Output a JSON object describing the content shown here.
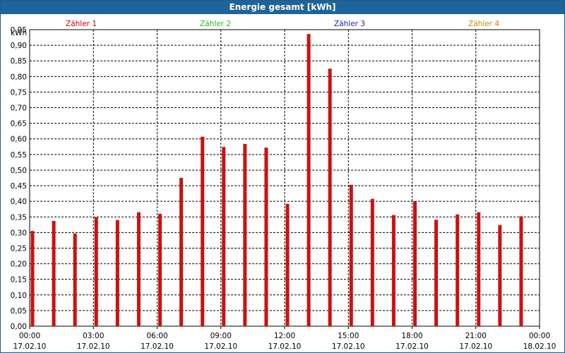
{
  "window": {
    "title": "Energie gesamt [kWh]"
  },
  "legend": [
    {
      "name": "Zähler 1",
      "color": "#cc0000"
    },
    {
      "name": "Zähler 2",
      "color": "#22bb22"
    },
    {
      "name": "Zähler 3",
      "color": "#2020aa"
    },
    {
      "name": "Zähler 4",
      "color": "#cc8800"
    }
  ],
  "chart_data": {
    "type": "bar",
    "title": "Energie gesamt [kWh]",
    "ylabel": "kWh",
    "ylim": [
      0,
      0.95
    ],
    "yticks": [
      "0,00",
      "0,05",
      "0,10",
      "0,15",
      "0,20",
      "0,25",
      "0,30",
      "0,35",
      "0,40",
      "0,45",
      "0,50",
      "0,55",
      "0,60",
      "0,65",
      "0,70",
      "0,75",
      "0,80",
      "0,85",
      "0,90",
      "0,95"
    ],
    "xticks": [
      {
        "time": "00:00",
        "date": "17.02.10"
      },
      {
        "time": "03:00",
        "date": "17.02.10"
      },
      {
        "time": "06:00",
        "date": "17.02.10"
      },
      {
        "time": "09:00",
        "date": "17.02.10"
      },
      {
        "time": "12:00",
        "date": "17.02.10"
      },
      {
        "time": "15:00",
        "date": "17.02.10"
      },
      {
        "time": "18:00",
        "date": "17.02.10"
      },
      {
        "time": "21:00",
        "date": "17.02.10"
      },
      {
        "time": "00:00",
        "date": "18.02.10"
      }
    ],
    "grid": true,
    "series": [
      {
        "name": "Zähler 1",
        "color": "#cc1111",
        "x": [
          "00:00",
          "01:00",
          "02:00",
          "03:00",
          "04:00",
          "05:00",
          "06:00",
          "07:00",
          "08:00",
          "09:00",
          "10:00",
          "11:00",
          "12:00",
          "13:00",
          "14:00",
          "15:00",
          "16:00",
          "17:00",
          "18:00",
          "19:00",
          "20:00",
          "21:00",
          "22:00",
          "23:00"
        ],
        "values": [
          0.305,
          0.337,
          0.297,
          0.349,
          0.34,
          0.365,
          0.36,
          0.475,
          0.607,
          0.574,
          0.584,
          0.572,
          0.392,
          0.936,
          0.825,
          0.453,
          0.408,
          0.356,
          0.4,
          0.341,
          0.358,
          0.365,
          0.324,
          0.352
        ]
      }
    ]
  }
}
